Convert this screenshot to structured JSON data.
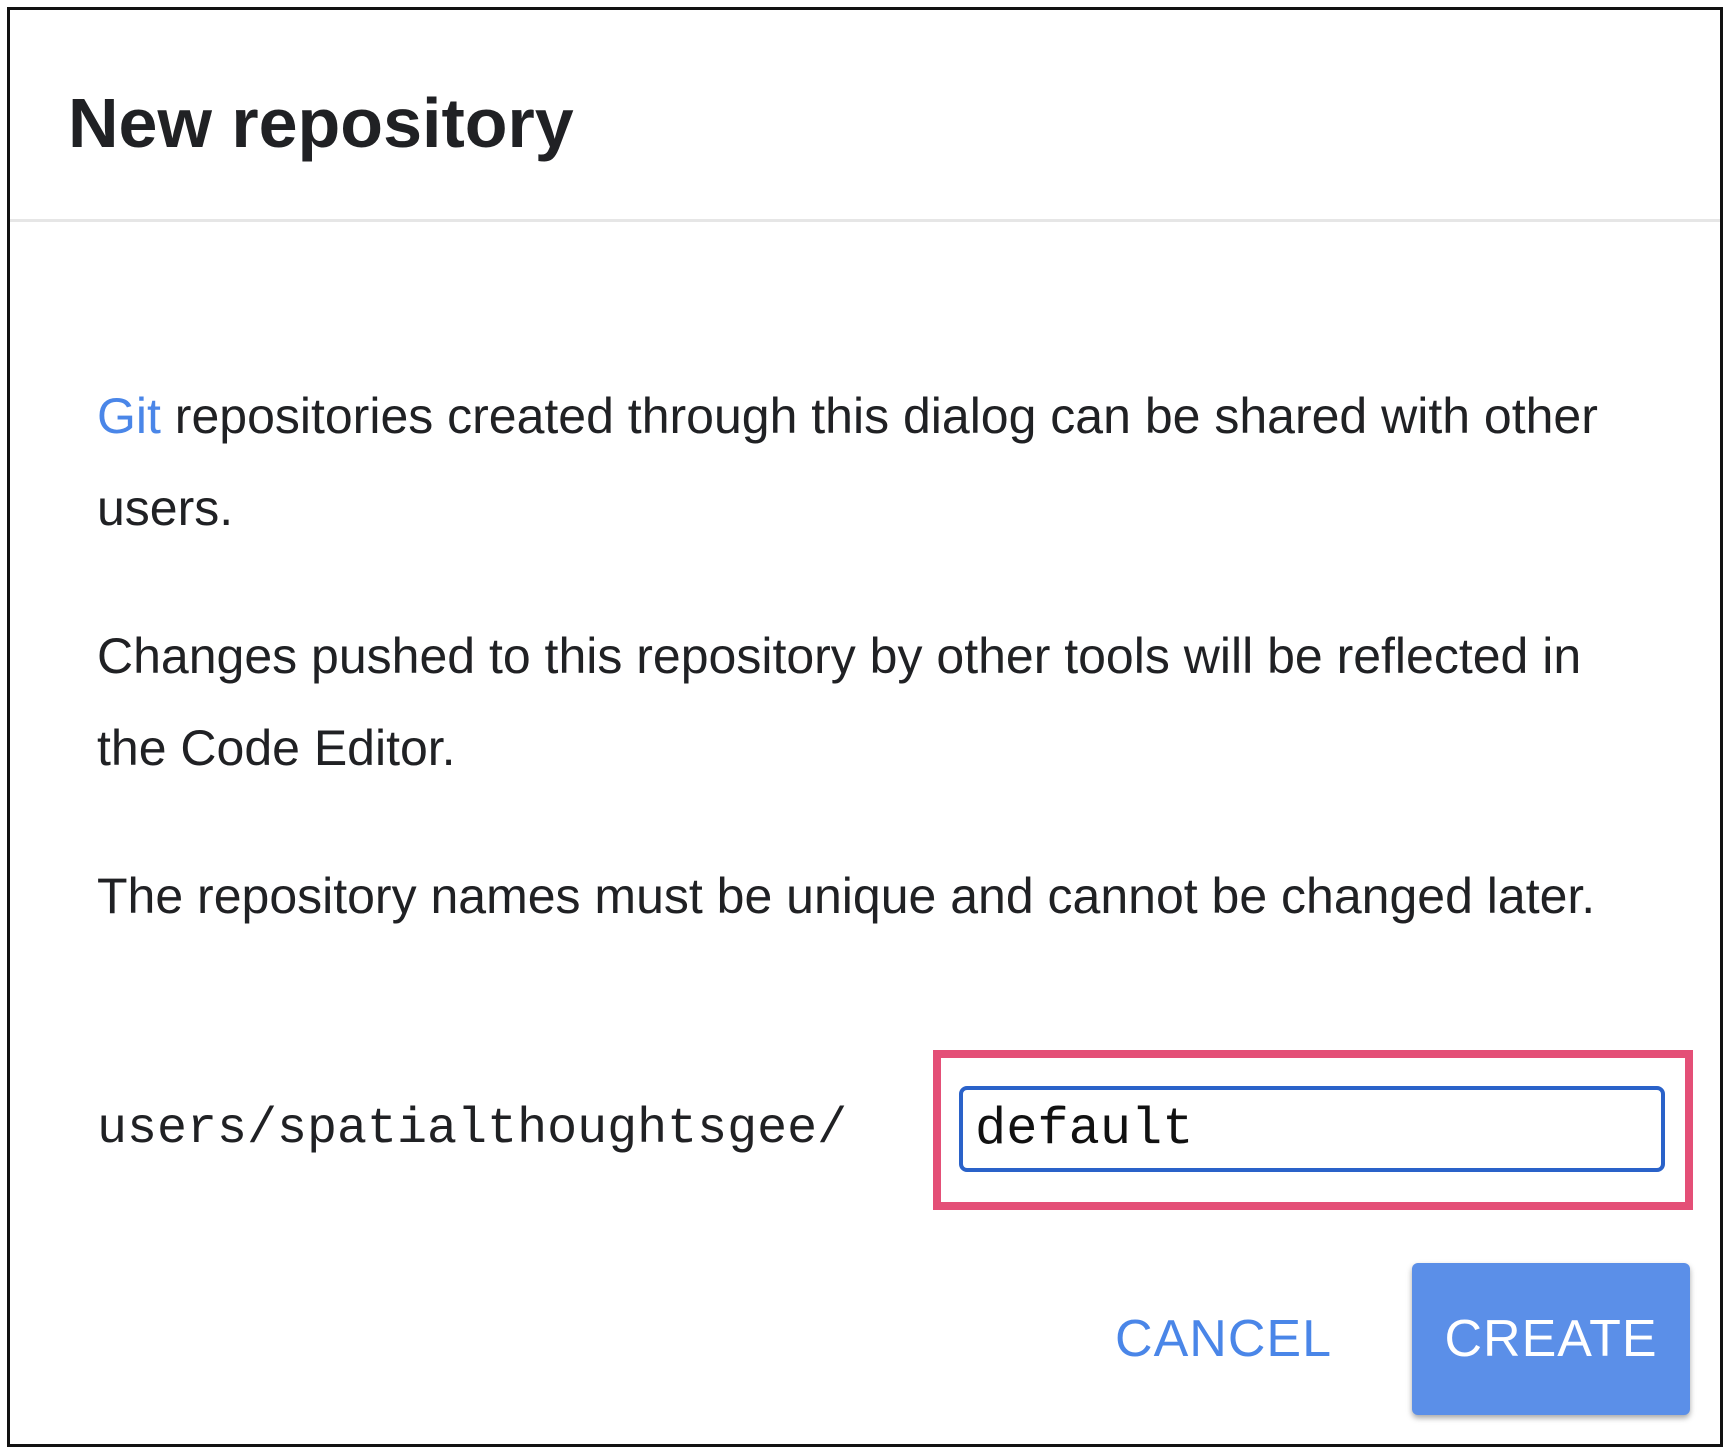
{
  "dialog": {
    "title": "New repository",
    "paragraphs": {
      "p1_link": "Git",
      "p1_rest": " repositories created through this dialog can be shared with other users.",
      "p2": "Changes pushed to this repository by other tools will be reflected in the Code Editor.",
      "p3": "The repository names must be unique and cannot be changed later."
    },
    "path_prefix": "users/spatialthoughtsgee/",
    "repo_name_input": {
      "value": "default"
    },
    "buttons": {
      "cancel": "CANCEL",
      "create": "CREATE"
    }
  },
  "colors": {
    "link": "#4a86e8",
    "primary_button": "#5b8fe8",
    "input_border": "#2a62c9",
    "highlight_box": "#e44f77"
  }
}
